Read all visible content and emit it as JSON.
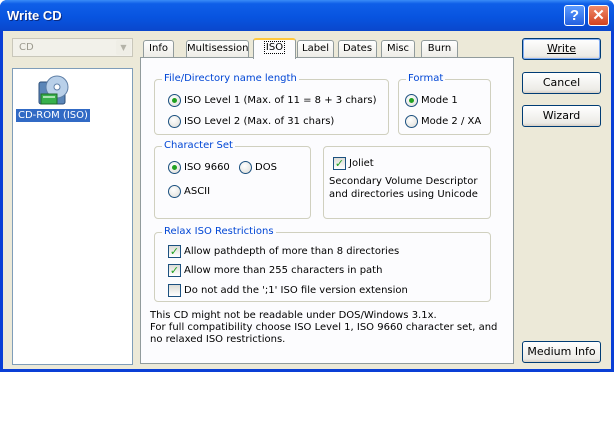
{
  "window": {
    "title": "Write CD",
    "help_label": "?",
    "close_label": "✕"
  },
  "combo": {
    "value": "CD",
    "arrow_icon": "chevron-down-icon"
  },
  "tree": {
    "item_label": "CD-ROM (ISO)",
    "item_icon": "cd-drive-icon"
  },
  "tabs": [
    "Info",
    "Multisession",
    "ISO",
    "Label",
    "Dates",
    "Misc",
    "Burn"
  ],
  "active_tab": "ISO",
  "iso": {
    "name_length": {
      "title": "File/Directory name length",
      "options": [
        "ISO Level 1 (Max. of 11 = 8 + 3 chars)",
        "ISO Level 2 (Max. of 31 chars)"
      ],
      "selected": 0
    },
    "format": {
      "title": "Format",
      "options": [
        "Mode 1",
        "Mode 2 / XA"
      ],
      "selected": 0
    },
    "charset": {
      "title": "Character Set",
      "options": [
        "ISO 9660",
        "DOS",
        "ASCII"
      ],
      "selected": 0
    },
    "joliet": {
      "label": "Joliet",
      "checked": true,
      "description_line1": "Secondary Volume Descriptor",
      "description_line2": "and directories using Unicode"
    },
    "relax": {
      "title": "Relax ISO Restrictions",
      "items": [
        {
          "label": "Allow pathdepth of more than 8 directories",
          "checked": true
        },
        {
          "label": "Allow more than 255 characters in path",
          "checked": true
        },
        {
          "label": "Do not add the ';1' ISO file version extension",
          "checked": false
        }
      ]
    },
    "info": {
      "line1": "This CD might not be readable under DOS/Windows 3.1x.",
      "line2": "For full compatibility choose ISO Level 1, ISO 9660 character set, and",
      "line3": "no relaxed ISO restrictions."
    }
  },
  "buttons": {
    "write": "Write",
    "cancel": "Cancel",
    "wizard": "Wizard",
    "medium_info": "Medium Info"
  },
  "colors": {
    "titlebar": "#0854e0",
    "group_title": "#0046d5",
    "selection": "#316ac5",
    "client": "#ece9d8"
  }
}
